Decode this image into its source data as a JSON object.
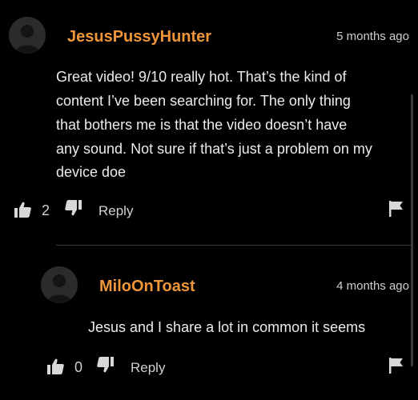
{
  "comments": [
    {
      "username": "JesusPussyHunter",
      "time": "5 months ago",
      "body_lines": [
        "Great video! 9/10 really hot. That’s the kind of",
        "content I’ve been searching for. The only thing",
        "that bothers me is that the video doesn’t have",
        "any sound. Not sure if that’s just a problem on my",
        "device doe"
      ],
      "likes": "2",
      "reply_label": "Reply"
    },
    {
      "username": "MiloOnToast",
      "time": "4 months ago",
      "body_lines": [
        "Jesus and I share a lot in common it seems"
      ],
      "likes": "0",
      "reply_label": "Reply"
    }
  ],
  "colors": {
    "background": "#000000",
    "username": "#f0963a",
    "text": "#ececec",
    "muted": "#cfcfcf"
  },
  "icons": [
    "avatar-placeholder-icon",
    "thumbs-up-icon",
    "thumbs-down-icon",
    "flag-icon"
  ]
}
